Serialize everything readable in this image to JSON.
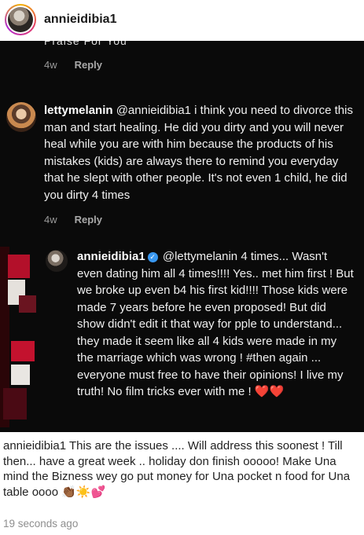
{
  "header": {
    "username": "annieidibia1"
  },
  "thread": {
    "cutoff_text": "Praise For You",
    "first_meta": {
      "time": "4w",
      "reply": "Reply"
    },
    "comment1": {
      "username": "lettymelanin",
      "mention": "@annieidibia1",
      "text": "i think you need to divorce this man and start healing. He did you dirty and you will never heal while you are with him because the products of his mistakes (kids) are always there to remind you everyday that he slept with other people. It's not even 1 child, he did you dirty 4 times",
      "time": "4w",
      "reply": "Reply"
    },
    "comment2": {
      "username": "annieidibia1",
      "verified_icon": "verified-badge-icon",
      "mention": "@lettymelanin",
      "text": "4 times... Wasn't even dating him all 4 times!!!! Yes.. met him first ! But we broke up even b4 his first kid!!!! Those kids were made 7 years before he even proposed! But did show didn't edit it that way for pple to understand... they made it seem like all 4 kids were made in my the marriage which was wrong ! #then again ... everyone must free to have their opinions! I live my truth! No film tricks ever with me !",
      "emojis": "❤️❤️"
    }
  },
  "caption": {
    "username": "annieidibia1",
    "text": "This are the issues .... Will address this soonest ! Till then... have a great week .. holiday don finish ooooo! Make Una mind the Bizness wey go put money for Una pocket n food for Una table oooo",
    "emojis": "👏🏾☀️💕"
  },
  "timestamp": "19 seconds ago",
  "colors": {
    "dark_bg": "#0a0a0a",
    "heart": "#e0245e",
    "verified": "#3897f0",
    "meta": "#9a9a9a"
  }
}
